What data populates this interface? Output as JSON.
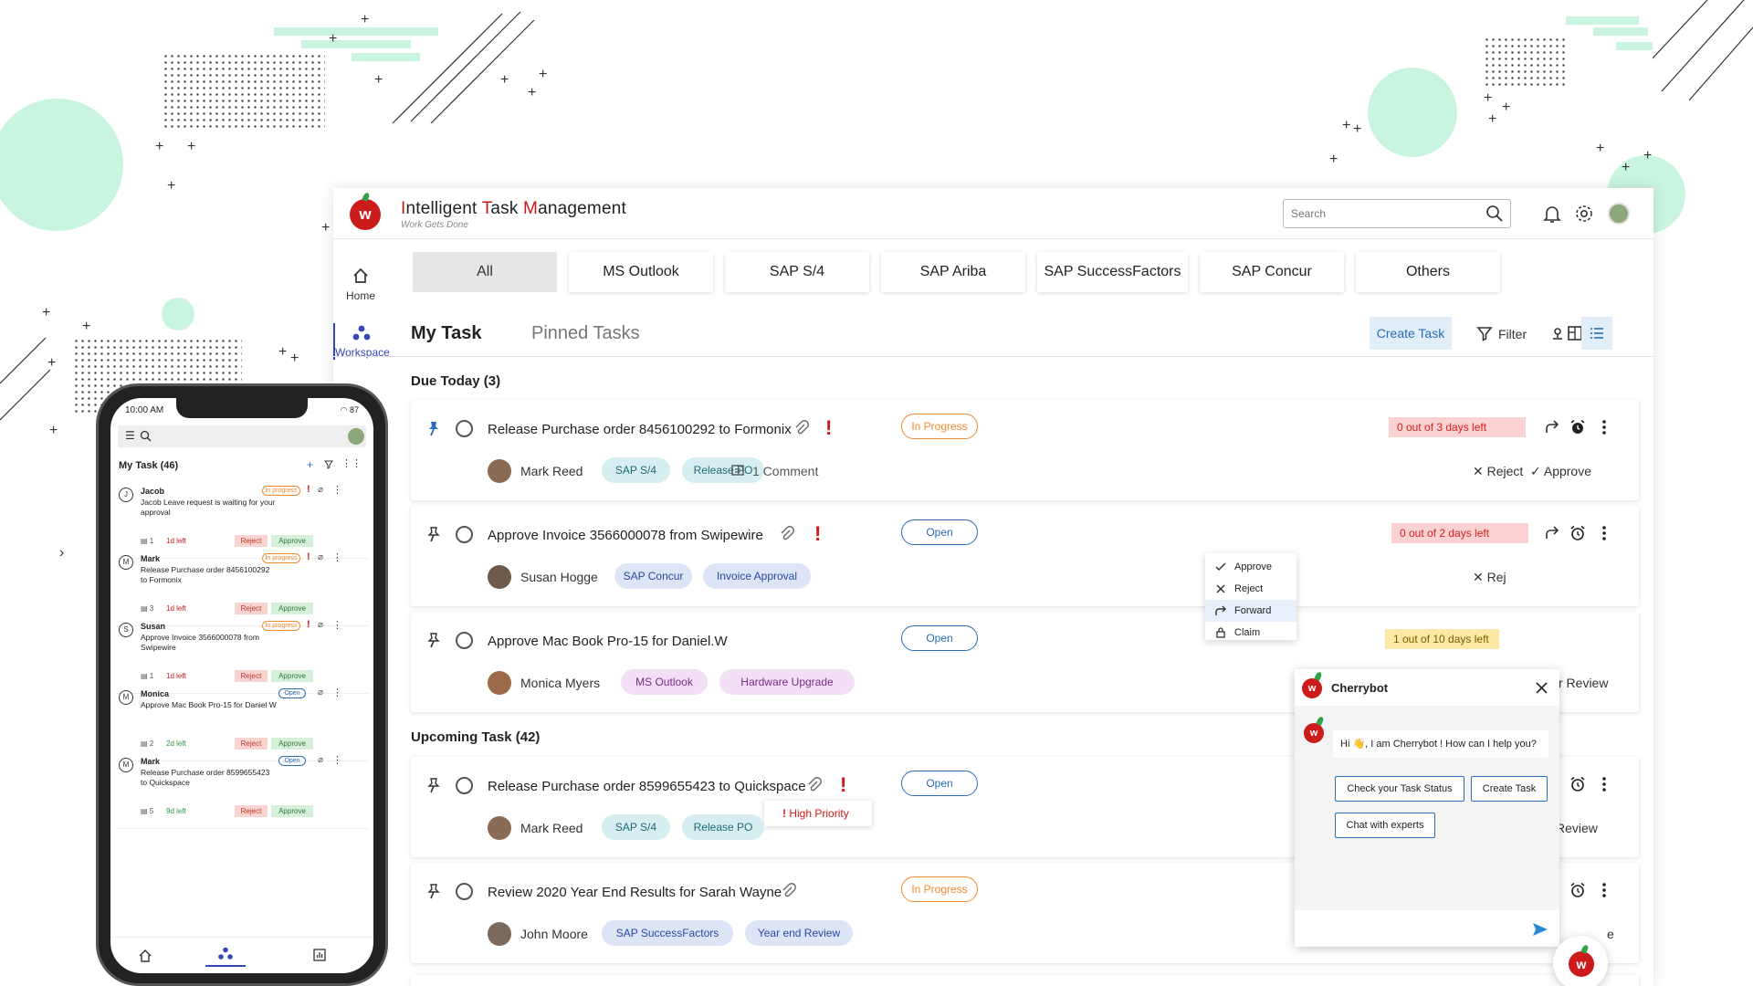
{
  "app": {
    "title_parts": [
      {
        "letter": "I",
        "rest": "ntelligent "
      },
      {
        "letter": "T",
        "rest": "ask "
      },
      {
        "letter": "M",
        "rest": "anagement"
      }
    ],
    "tagline": "Work Gets Done",
    "logo_letter": "w",
    "search_placeholder": "Search"
  },
  "rail": {
    "home": "Home",
    "workspace": "Workspace"
  },
  "tabs": [
    "All",
    "MS Outlook",
    "SAP S/4",
    "SAP Ariba",
    "SAP SuccessFactors",
    "SAP Concur",
    "Others"
  ],
  "subheader": {
    "my_task": "My Task",
    "pinned": "Pinned Tasks",
    "create": "Create Task",
    "filter": "Filter"
  },
  "sections": {
    "due_today": "Due Today (3)",
    "upcoming": "Upcoming Task (42)"
  },
  "tasks": [
    {
      "title": "Release Purchase order 8456100292 to Formonix",
      "status": "In Progress",
      "days_left": "0 out of 3 days left",
      "assignee": "Mark Reed",
      "tags": [
        "SAP S/4",
        "Release PO"
      ],
      "comment": "1 Comment",
      "reject": "Reject",
      "approve": "Approve"
    },
    {
      "title": "Approve Invoice 3566000078 from Swipewire",
      "status": "Open",
      "days_left": "0 out of 2 days left",
      "assignee": "Susan Hogge",
      "tags": [
        "SAP Concur",
        "Invoice Approval"
      ],
      "reject_partial": "Rej"
    },
    {
      "title": "Approve Mac Book Pro-15 for Daniel.W",
      "status": "Open",
      "days_left": "1 out of 10 days left",
      "assignee": "Monica Myers",
      "tags": [
        "MS Outlook",
        "Hardware Upgrade"
      ],
      "right_partial": "r Review"
    },
    {
      "title": "Release Purchase order 8599655423 to Quickspace",
      "status": "Open",
      "tooltip": "High Priority",
      "assignee": "Mark Reed",
      "tags": [
        "SAP S/4",
        "Release PO"
      ],
      "right_partial": "Review"
    },
    {
      "title": "Review 2020 Year End Results for Sarah Wayne",
      "status": "In Progress",
      "assignee": "John Moore",
      "tags": [
        "SAP SuccessFactors",
        "Year end Review"
      ],
      "right_partial": "e"
    }
  ],
  "context_menu": {
    "items": [
      "Approve",
      "Reject",
      "Forward",
      "Claim"
    ],
    "highlighted": "Forward"
  },
  "chatbot": {
    "name": "Cherrybot",
    "greeting": "Hi 👋, I am Cherrybot ! How can I help you?",
    "buttons": [
      "Check your Task Status",
      "Create Task",
      "Chat with experts"
    ]
  },
  "phone": {
    "time": "10:00 AM",
    "battery": "87",
    "my_task": "My Task (46)",
    "cards": [
      {
        "initial": "J",
        "name": "Jacob",
        "desc": "Jacob Leave request is waiting for your approval",
        "status": "In progress",
        "priority": true,
        "count": "1",
        "left": "1d left",
        "left_color": "#d01818"
      },
      {
        "initial": "M",
        "name": "Mark",
        "desc": "Release Purchase order 8456100292 to Formonix",
        "status": "In progress",
        "priority": true,
        "count": "3",
        "left": "1d left",
        "left_color": "#d01818"
      },
      {
        "initial": "S",
        "name": "Susan",
        "desc": "Approve Invoice 3566000078 from Swipewire",
        "status": "In progress",
        "priority": true,
        "count": "1",
        "left": "1d left",
        "left_color": "#d01818"
      },
      {
        "initial": "M",
        "name": "Monica",
        "desc": "Approve Mac Book Pro-15 for Daniel W",
        "status": "Open",
        "priority": false,
        "count": "2",
        "left": "2d left",
        "left_color": "#2f9a3e"
      },
      {
        "initial": "M",
        "name": "Mark",
        "desc": "Release Purchase order 8599655423 to Quickspace",
        "status": "Open",
        "priority": false,
        "count": "5",
        "left": "9d left",
        "left_color": "#2f9a3e"
      }
    ],
    "reject": "Reject",
    "approve": "Approve"
  },
  "colors": {
    "brand_red": "#cc1b1b",
    "accent_blue": "#2a6cb8",
    "mint": "#c9f5e0"
  }
}
